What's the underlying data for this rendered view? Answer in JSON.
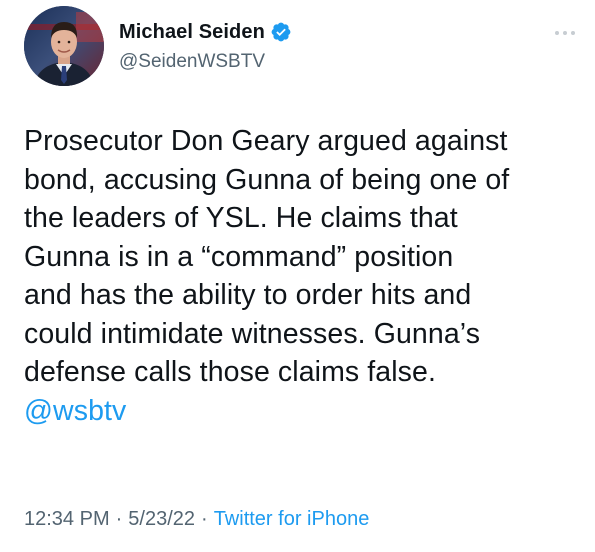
{
  "author": {
    "display_name": "Michael Seiden",
    "handle": "@SeidenWSBTV",
    "verified": true
  },
  "tweet": {
    "lines": [
      "Prosecutor Don Geary argued against",
      "bond, accusing Gunna of being one of",
      "the leaders of YSL. He claims that",
      "Gunna is in a “command” position",
      "and has the ability to order hits and",
      "could intimidate witnesses. Gunna’s",
      "defense calls those claims false."
    ],
    "mention": "@wsbtv"
  },
  "meta": {
    "time": "12:34 PM",
    "date": "5/23/22",
    "source": "Twitter for iPhone",
    "separator": "·"
  },
  "icons": {
    "verified": "verified-badge-icon",
    "more": "more-options-icon"
  },
  "colors": {
    "accent": "#1d9bf0",
    "text": "#0f1419",
    "secondary": "#536471"
  }
}
